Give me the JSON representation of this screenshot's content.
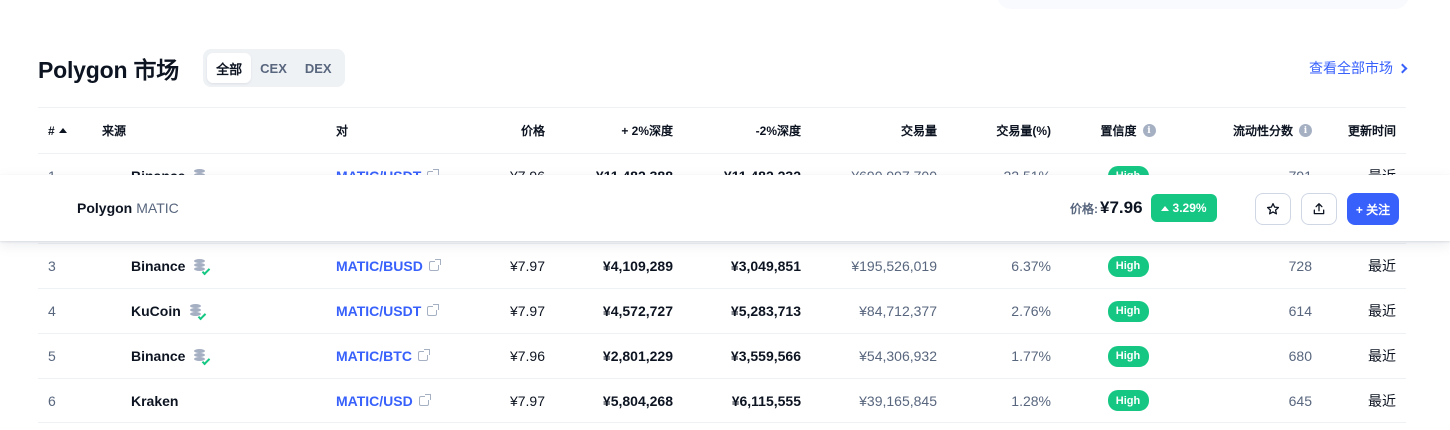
{
  "header": {
    "title": "Polygon 市场",
    "filters": [
      "全部",
      "CEX",
      "DEX"
    ],
    "active_filter": "全部",
    "view_all": "查看全部市场"
  },
  "columns": {
    "rank": "#",
    "source": "来源",
    "pair": "对",
    "price": "价格",
    "depth_plus": "+ 2%深度",
    "depth_minus": "-2%深度",
    "volume": "交易量",
    "volume_pct": "交易量(%)",
    "confidence": "置信度",
    "liquidity": "流动性分数",
    "updated": "更新时间"
  },
  "rows": [
    {
      "rank": "1",
      "source": "Binance",
      "pair": "MATIC/USDT",
      "price": "¥7.96",
      "depth_plus": "¥11,482,388",
      "depth_minus": "¥11,482,232",
      "volume": "¥690,997,700",
      "volume_pct": "22.51%",
      "confidence": "High",
      "liquidity": "791",
      "updated": "最近"
    },
    {
      "rank": "3",
      "source": "Binance",
      "pair": "MATIC/BUSD",
      "price": "¥7.97",
      "depth_plus": "¥4,109,289",
      "depth_minus": "¥3,049,851",
      "volume": "¥195,526,019",
      "volume_pct": "6.37%",
      "confidence": "High",
      "liquidity": "728",
      "updated": "最近"
    },
    {
      "rank": "4",
      "source": "KuCoin",
      "pair": "MATIC/USDT",
      "price": "¥7.97",
      "depth_plus": "¥4,572,727",
      "depth_minus": "¥5,283,713",
      "volume": "¥84,712,377",
      "volume_pct": "2.76%",
      "confidence": "High",
      "liquidity": "614",
      "updated": "最近"
    },
    {
      "rank": "5",
      "source": "Binance",
      "pair": "MATIC/BTC",
      "price": "¥7.96",
      "depth_plus": "¥2,801,229",
      "depth_minus": "¥3,559,566",
      "volume": "¥54,306,932",
      "volume_pct": "1.77%",
      "confidence": "High",
      "liquidity": "680",
      "updated": "最近"
    },
    {
      "rank": "6",
      "source": "Kraken",
      "pair": "MATIC/USD",
      "price": "¥7.97",
      "depth_plus": "¥5,804,268",
      "depth_minus": "¥6,115,555",
      "volume": "¥39,165,845",
      "volume_pct": "1.28%",
      "confidence": "High",
      "liquidity": "645",
      "updated": "最近"
    }
  ],
  "sticky_bar": {
    "coin_name": "Polygon",
    "coin_symbol": "MATIC",
    "price_label": "价格:",
    "price_value": "¥7.96",
    "change": "3.29%",
    "follow_label": "+ 关注"
  },
  "colors": {
    "accent": "#3861fb",
    "positive": "#16c784",
    "text_primary": "#0d1421",
    "text_secondary": "#58667e"
  }
}
